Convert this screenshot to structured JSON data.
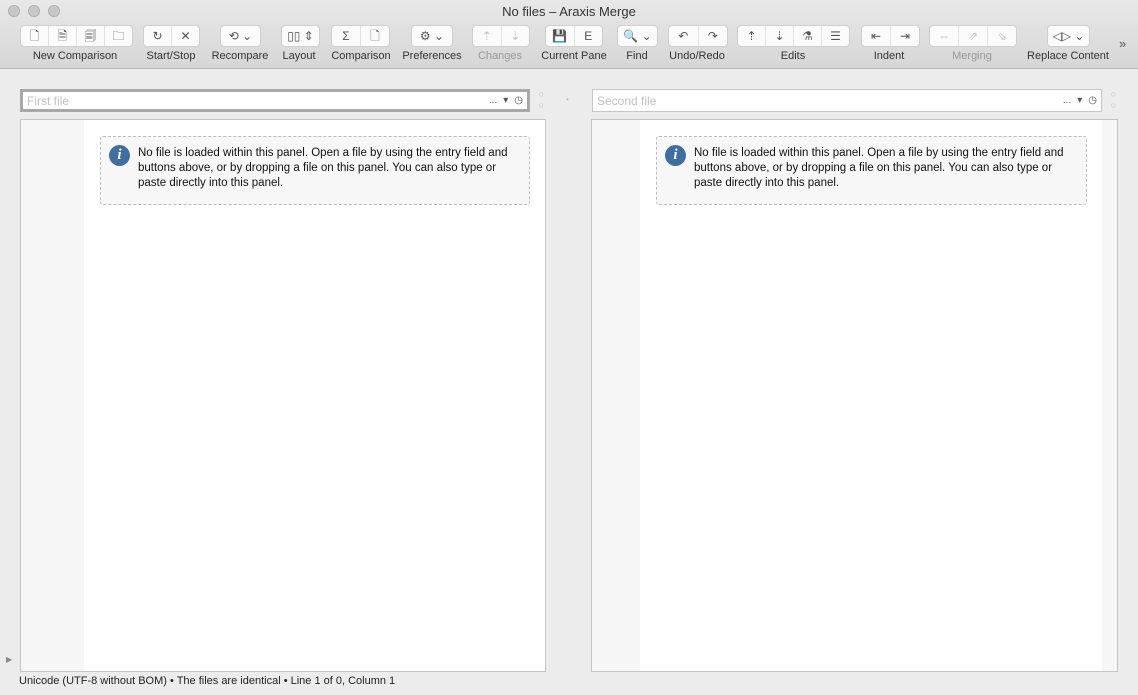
{
  "window": {
    "title": "No files – Araxis Merge"
  },
  "toolbar": {
    "groups": [
      {
        "label": "New Comparison",
        "icons": [
          "🗋",
          "🗎",
          "🗐",
          "🗀"
        ],
        "enabled": true
      },
      {
        "label": "Start/Stop",
        "icons": [
          "↻",
          "✕"
        ],
        "enabled": true
      },
      {
        "label": "Recompare",
        "icons": [
          "⟲ ⌄"
        ],
        "enabled": true
      },
      {
        "label": "Layout",
        "icons": [
          "▯▯ ⇕"
        ],
        "enabled": true
      },
      {
        "label": "Comparison",
        "icons": [
          "Σ",
          "🗋"
        ],
        "enabled": true
      },
      {
        "label": "Preferences",
        "icons": [
          "⚙ ⌄"
        ],
        "enabled": true
      },
      {
        "label": "Changes",
        "icons": [
          "⇡",
          "⇣"
        ],
        "enabled": false
      },
      {
        "label": "Current Pane",
        "icons": [
          "💾",
          "E"
        ],
        "enabled": true
      },
      {
        "label": "Find",
        "icons": [
          "🔍 ⌄"
        ],
        "enabled": true
      },
      {
        "label": "Undo/Redo",
        "icons": [
          "↶",
          "↷"
        ],
        "enabled": true
      },
      {
        "label": "Edits",
        "icons": [
          "⇡",
          "⇣",
          "⚗",
          "☰"
        ],
        "enabled": true
      },
      {
        "label": "Indent",
        "icons": [
          "⇤",
          "⇥"
        ],
        "enabled": true
      },
      {
        "label": "Merging",
        "icons": [
          "⇔",
          "⇗",
          "⇘"
        ],
        "enabled": false
      },
      {
        "label": "Replace Content",
        "icons": [
          "◁▷ ⌄"
        ],
        "enabled": true
      }
    ],
    "overflow": "»"
  },
  "left": {
    "placeholder": "First file",
    "value": "",
    "menu": "...",
    "dropdown": "▾",
    "history": "◷",
    "message": "No file is loaded within this panel. Open a file by using the entry field and buttons above, or by dropping a file on this panel. You can also type or paste directly into this panel."
  },
  "right": {
    "placeholder": "Second file",
    "value": "",
    "menu": "...",
    "dropdown": "▾",
    "history": "◷",
    "message": "No file is loaded within this panel. Open a file by using the entry field and buttons above, or by dropping a file on this panel. You can also type or paste directly into this panel."
  },
  "status": {
    "text": "Unicode (UTF-8 without BOM) • The files are identical • Line 1 of 0, Column 1"
  }
}
